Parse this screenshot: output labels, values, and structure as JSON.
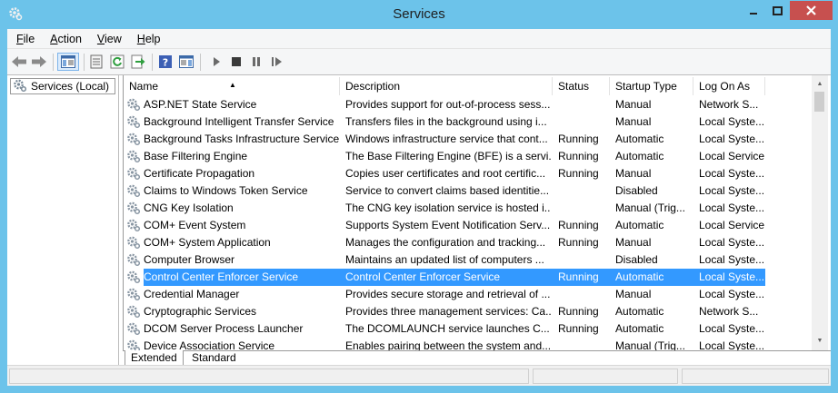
{
  "window": {
    "title": "Services"
  },
  "menu": [
    {
      "label": "File",
      "accel": "F",
      "rest": "ile"
    },
    {
      "label": "Action",
      "accel": "A",
      "rest": "ction"
    },
    {
      "label": "View",
      "accel": "V",
      "rest": "iew"
    },
    {
      "label": "Help",
      "accel": "H",
      "rest": "elp"
    }
  ],
  "toolbar_icons": [
    "back-arrow-icon",
    "forward-arrow-icon",
    "show-console-tree-icon",
    "properties-icon",
    "refresh-icon",
    "export-list-icon",
    "help-icon",
    "show-action-pane-icon",
    "start-service-icon",
    "stop-service-icon",
    "pause-service-icon",
    "restart-service-icon"
  ],
  "tree": {
    "root_label": "Services (Local)"
  },
  "columns": {
    "name": "Name",
    "description": "Description",
    "status": "Status",
    "startup": "Startup Type",
    "logon": "Log On As"
  },
  "services": [
    {
      "name": "ASP.NET State Service",
      "description": "Provides support for out-of-process sess...",
      "status": "",
      "startup": "Manual",
      "logon": "Network S..."
    },
    {
      "name": "Background Intelligent Transfer Service",
      "description": "Transfers files in the background using i...",
      "status": "",
      "startup": "Manual",
      "logon": "Local Syste..."
    },
    {
      "name": "Background Tasks Infrastructure Service",
      "description": "Windows infrastructure service that cont...",
      "status": "Running",
      "startup": "Automatic",
      "logon": "Local Syste..."
    },
    {
      "name": "Base Filtering Engine",
      "description": "The Base Filtering Engine (BFE) is a servi...",
      "status": "Running",
      "startup": "Automatic",
      "logon": "Local Service"
    },
    {
      "name": "Certificate Propagation",
      "description": "Copies user certificates and root certific...",
      "status": "Running",
      "startup": "Manual",
      "logon": "Local Syste..."
    },
    {
      "name": "Claims to Windows Token Service",
      "description": "Service to convert claims based identitie...",
      "status": "",
      "startup": "Disabled",
      "logon": "Local Syste..."
    },
    {
      "name": "CNG Key Isolation",
      "description": "The CNG key isolation service is hosted i...",
      "status": "",
      "startup": "Manual (Trig...",
      "logon": "Local Syste..."
    },
    {
      "name": "COM+ Event System",
      "description": "Supports System Event Notification Serv...",
      "status": "Running",
      "startup": "Automatic",
      "logon": "Local Service"
    },
    {
      "name": "COM+ System Application",
      "description": "Manages the configuration and tracking...",
      "status": "Running",
      "startup": "Manual",
      "logon": "Local Syste..."
    },
    {
      "name": "Computer Browser",
      "description": "Maintains an updated list of computers ...",
      "status": "",
      "startup": "Disabled",
      "logon": "Local Syste..."
    },
    {
      "name": "Control Center Enforcer Service",
      "description": "Control Center Enforcer Service",
      "status": "Running",
      "startup": "Automatic",
      "logon": "Local Syste...",
      "selected": true
    },
    {
      "name": "Credential Manager",
      "description": "Provides secure storage and retrieval of ...",
      "status": "",
      "startup": "Manual",
      "logon": "Local Syste..."
    },
    {
      "name": "Cryptographic Services",
      "description": "Provides three management services: Ca...",
      "status": "Running",
      "startup": "Automatic",
      "logon": "Network S..."
    },
    {
      "name": "DCOM Server Process Launcher",
      "description": "The DCOMLAUNCH service launches C...",
      "status": "Running",
      "startup": "Automatic",
      "logon": "Local Syste..."
    },
    {
      "name": "Device Association Service",
      "description": "Enables pairing between the system and...",
      "status": "",
      "startup": "Manual (Trig...",
      "logon": "Local Syste..."
    }
  ],
  "tabs": [
    {
      "label": "Extended",
      "active": true
    },
    {
      "label": "Standard",
      "active": false
    }
  ],
  "colors": {
    "accent": "#6cc3ea",
    "selection": "#3399ff",
    "close": "#c7504f"
  }
}
